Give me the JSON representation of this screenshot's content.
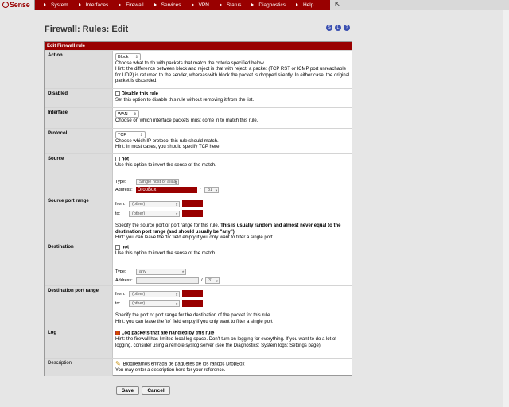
{
  "nav": {
    "logo_text": "Sense",
    "items": [
      "System",
      "Interfaces",
      "Firewall",
      "Services",
      "VPN",
      "Status",
      "Diagnostics",
      "Help"
    ]
  },
  "page": {
    "title": "Firewall: Rules: Edit",
    "header": "Edit Firewall rule"
  },
  "action": {
    "label": "Action",
    "value": "Block",
    "help1": "Choose what to do with packets that match the criteria specified below.",
    "help2": "Hint: the difference between block and reject is that with reject, a packet (TCP RST or ICMP port unreachable for UDP) is returned to the sender, whereas with block the packet is dropped silently. In either case, the original packet is discarded."
  },
  "disabled": {
    "label": "Disabled",
    "check": "Disable this rule",
    "help": "Set this option to disable this rule without removing it from the list."
  },
  "interface": {
    "label": "Interface",
    "value": "WAN",
    "help": "Choose on which interface packets must come in to match this rule."
  },
  "protocol": {
    "label": "Protocol",
    "value": "TCP",
    "help1": "Choose which IP protocol this rule should match.",
    "help2": "Hint: in most cases, you should specify TCP  here."
  },
  "source": {
    "label": "Source",
    "not": "not",
    "help": "Use this option to invert the sense of the match.",
    "type_label": "Type:",
    "type_value": "Single host or alias",
    "address_label": "Address:",
    "address_value": "DropBox",
    "slash": "/",
    "mask": "31"
  },
  "source_port": {
    "label": "Source port range",
    "from": "from:",
    "to": "to:",
    "other": "(other)",
    "help_a": "Specify the source port or port range for this rule. ",
    "help_b": "This is usually random and almost never equal to the destination port range (and should usually be \"any\").",
    "help_c": "Hint: you can leave the 'to' field empty if you only want to filter a single port."
  },
  "destination": {
    "label": "Destination",
    "not": "not",
    "help": "Use this option to invert the sense of the match.",
    "type_label": "Type:",
    "type_value": "any",
    "address_label": "Address:",
    "slash": "/",
    "mask": "31"
  },
  "dest_port": {
    "label": "Destination port range",
    "from": "from:",
    "to": "to:",
    "other": "(other)",
    "help1": "Specify the port or port range for the destination of the packet for this rule.",
    "help2": "Hint: you can leave the 'to' field empty if you only want to filter a single port"
  },
  "log": {
    "label": "Log",
    "check": "Log packets that are handled by this rule",
    "help": "Hint: the firewall has limited local log space. Don't turn on logging for everything. If you want to do a lot of logging, consider using a remote syslog server (see the Diagnostics: System logs: Settings page)."
  },
  "description": {
    "label": "Description",
    "value": "Bloqueamos entrada de paquetes de los rangos DropBox",
    "help": "You may enter a description here for your reference."
  },
  "buttons": {
    "save": "Save",
    "cancel": "Cancel"
  },
  "colors": {
    "brand": "#990000",
    "label_bg": "#dddddd"
  }
}
